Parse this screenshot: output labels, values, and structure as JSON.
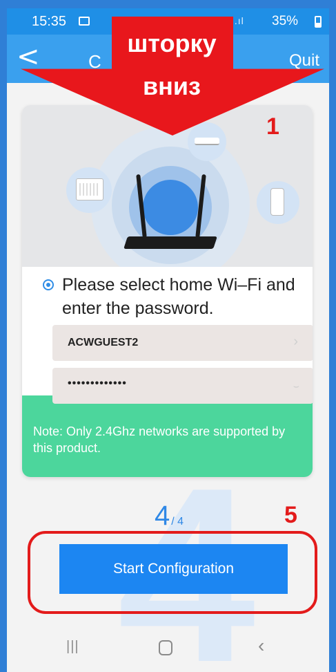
{
  "status_bar": {
    "time": "15:35",
    "signal": "⁴ᴳ .ıl",
    "battery": "35%"
  },
  "nav_bar": {
    "back": "<",
    "title": "C",
    "quit": "Quit"
  },
  "instruction": "Please select home Wi–Fi and enter the password.",
  "wifi": {
    "ssid": "ACWGUEST2",
    "password_mask": "•••••••••••••"
  },
  "note": "Note: Only 2.4Ghz networks are supported by this product.",
  "step": {
    "current": "4",
    "total": "/ 4"
  },
  "start_button": "Start Configuration",
  "annotations": {
    "arrow_line1": "шторку",
    "arrow_line2": "вниз",
    "marker_1": "1",
    "marker_5": "5"
  },
  "colors": {
    "nav_blue": "#3aa0ee",
    "button_blue": "#1c86f2",
    "note_green": "#4cd69c",
    "annotation_red": "#e8171c"
  }
}
